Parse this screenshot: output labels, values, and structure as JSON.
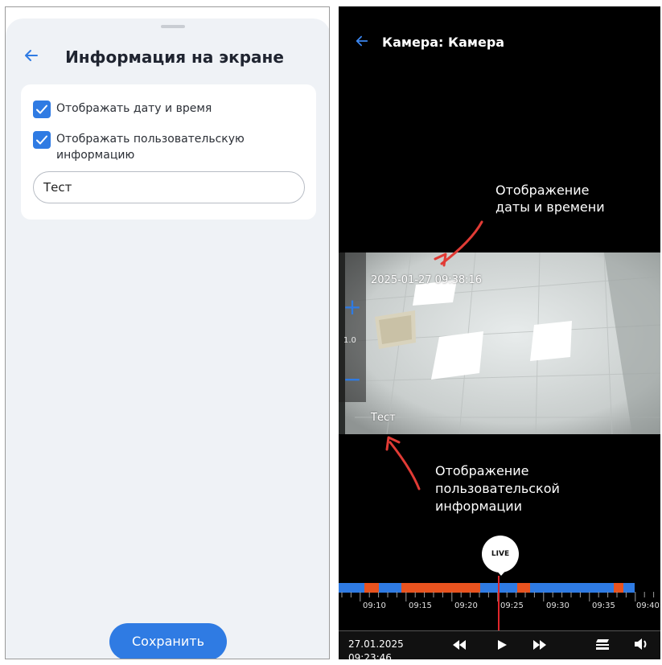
{
  "settings_screen": {
    "title": "Информация на экране",
    "show_datetime": {
      "label": "Отображать дату и время",
      "checked": true
    },
    "show_user_info": {
      "label": "Отображать пользовательскую информацию",
      "checked": true
    },
    "user_text_value": "Тест",
    "save_label": "Сохранить",
    "accent_color": "#2f7be3"
  },
  "camera_screen": {
    "title": "Камера: Камера",
    "osd_datetime": "2025-01-27 09:38:16",
    "osd_user_text": "Тест",
    "zoom_level": "1.0",
    "annotation_datetime": "Отображение даты и времени",
    "annotation_user_info": "Отображение пользовательской информации",
    "live_label": "LIVE",
    "timeline_labels": [
      "09:10",
      "09:15",
      "09:20",
      "09:25",
      "09:30",
      "09:35",
      "09:40"
    ],
    "timeline_colors": {
      "recording": "#2f7be3",
      "event": "#e8531f",
      "cursor": "#e0262b"
    },
    "current_date": "27.01.2025",
    "current_time": "09:23:46"
  }
}
